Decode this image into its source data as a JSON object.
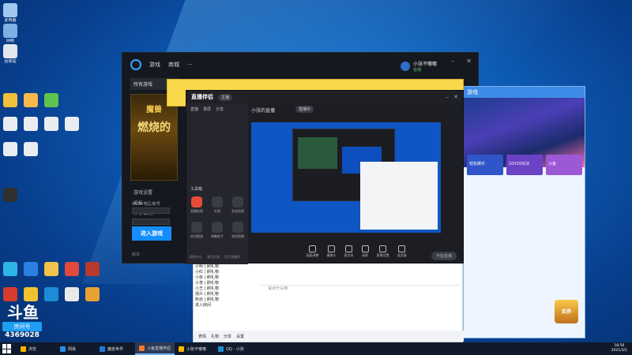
{
  "desktop": {
    "icons": [
      {
        "label": "此电脑",
        "color": "#9fc7f0"
      },
      {
        "label": "网络",
        "color": "#7fb0e4"
      },
      {
        "label": "回收站",
        "color": "#dfe6ee"
      },
      {
        "label": "",
        "color": "#f0c03a"
      },
      {
        "label": "",
        "color": "#f6b94a"
      },
      {
        "label": "",
        "color": "#5fc44d"
      },
      {
        "label": "",
        "color": "#e9edf2"
      },
      {
        "label": "",
        "color": "#e9edf2"
      },
      {
        "label": "",
        "color": "#e9edf2"
      },
      {
        "label": "",
        "color": "#e9edf2"
      },
      {
        "label": "",
        "color": "#e9edf2"
      },
      {
        "label": "",
        "color": "#e9edf2"
      },
      {
        "label": "",
        "color": "#303030"
      },
      {
        "label": "",
        "color": "#2fb4e8"
      },
      {
        "label": "",
        "color": "#2b7fe0"
      },
      {
        "label": "",
        "color": "#f1c34b"
      },
      {
        "label": "",
        "color": "#e24a3b"
      },
      {
        "label": "",
        "color": "#d83a2e"
      },
      {
        "label": "",
        "color": "#f2c230"
      },
      {
        "label": "",
        "color": "#1d8bd6"
      },
      {
        "label": "",
        "color": "#e9e9e9"
      },
      {
        "label": "",
        "color": "#e8a232"
      },
      {
        "label": "",
        "color": "#b83a2b"
      }
    ],
    "douyu": {
      "logo": "斗鱼",
      "name": "房间号",
      "number": "4369028"
    }
  },
  "battlenet": {
    "tabs": [
      "游戏",
      "商城",
      "···"
    ],
    "user": "小张不嘟嘟",
    "status": "在线",
    "game_tab": "所有游戏",
    "banner_t1": "魔兽",
    "banner_t2": "燃烧的",
    "links": [
      "游戏设置",
      "论坛",
      "补丁说明"
    ],
    "region_label": "WoW 地区/账号",
    "play_label": "进入游戏",
    "version": "版本"
  },
  "stream": {
    "logo": "直播伴侣",
    "badge": "主播",
    "title": "小张的直播",
    "live_pill": "直播中",
    "left_tabs": [
      "直播",
      "录屏",
      "分享"
    ],
    "tools_heading": "工具箱",
    "tools": [
      "直播贴图",
      "礼物",
      "发起投票",
      "房间管理",
      "弹幕助手",
      "游戏直播",
      "直播分享",
      "设置"
    ],
    "toolbar": [
      "画面调整",
      "摄像头",
      "麦克风",
      "录屏",
      "直播设置",
      "混音器"
    ],
    "start_label": "开始直播",
    "footer": [
      "帮助中心",
      "意见反馈",
      "官方直播间"
    ]
  },
  "chat": {
    "list": [
      "小明 | 刷礼物",
      "小红 | 刷礼物",
      "小张 | 刷礼物",
      "小李 | 刷礼物",
      "小王 | 刷礼物",
      "观众 | 刷礼物",
      "粉丝 | 刷礼物",
      "进入房间"
    ],
    "input_placeholder": "说点什么吧",
    "bottom": [
      "表情",
      "礼物",
      "分享",
      "设置"
    ]
  },
  "game_client": {
    "title": "游戏",
    "cards": [
      "轻松娱乐",
      "10V10对决",
      "斗鱼"
    ],
    "badge": "奖券"
  },
  "taskbar": {
    "items": [
      {
        "label": "浏览",
        "color": "#ffb400",
        "active": false
      },
      {
        "label": "网易",
        "color": "#2b8ae6",
        "active": false
      },
      {
        "label": "魔兽世界",
        "color": "#1d7ad6",
        "active": false
      },
      {
        "label": "斗鱼直播伴侣",
        "color": "#f47a2a",
        "active": true
      },
      {
        "label": "小张不嘟嘟",
        "color": "#ffb400",
        "active": false
      },
      {
        "label": "QQ - 小张",
        "color": "#1d8bd6",
        "active": false
      }
    ],
    "time": "18:56",
    "date": "2021/3/1"
  }
}
